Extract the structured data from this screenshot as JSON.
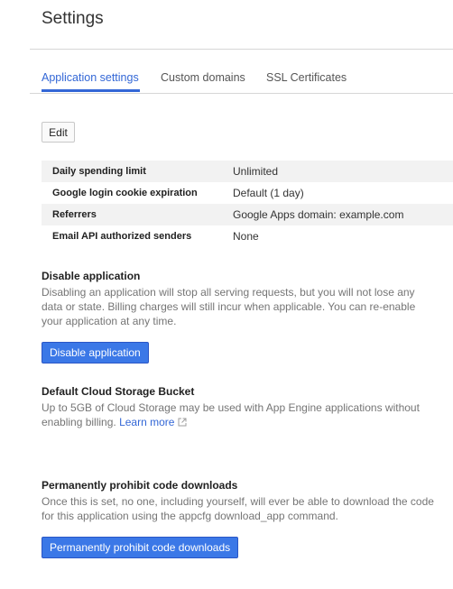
{
  "page": {
    "title": "Settings"
  },
  "tabs": [
    {
      "label": "Application settings",
      "active": true
    },
    {
      "label": "Custom domains",
      "active": false
    },
    {
      "label": "SSL Certificates",
      "active": false
    }
  ],
  "toolbar": {
    "edit_label": "Edit"
  },
  "settings_table": {
    "rows": [
      {
        "key": "Daily spending limit",
        "value": "Unlimited"
      },
      {
        "key": "Google login cookie expiration",
        "value": "Default (1 day)"
      },
      {
        "key": "Referrers",
        "value": "Google Apps domain: example.com"
      },
      {
        "key": "Email API authorized senders",
        "value": "None"
      }
    ]
  },
  "disable_section": {
    "heading": "Disable application",
    "description": "Disabling an application will stop all serving requests, but you will not lose any data or state. Billing charges will still incur when applicable. You can re-enable your application at any time.",
    "button_label": "Disable application"
  },
  "storage_section": {
    "heading": "Default Cloud Storage Bucket",
    "description": "Up to 5GB of Cloud Storage may be used with App Engine applications without enabling billing.",
    "link_label": "Learn more",
    "link_icon": "external-link-icon"
  },
  "prohibit_section": {
    "heading": "Permanently prohibit code downloads",
    "description": "Once this is set, no one, including yourself, will ever be able to download the code for this application using the appcfg download_app command.",
    "button_label": "Permanently prohibit code downloads"
  },
  "colors": {
    "accent": "#3367d6",
    "primary_button": "#3b78e7",
    "table_stripe": "#f2f2f2",
    "muted_text": "#757575"
  }
}
